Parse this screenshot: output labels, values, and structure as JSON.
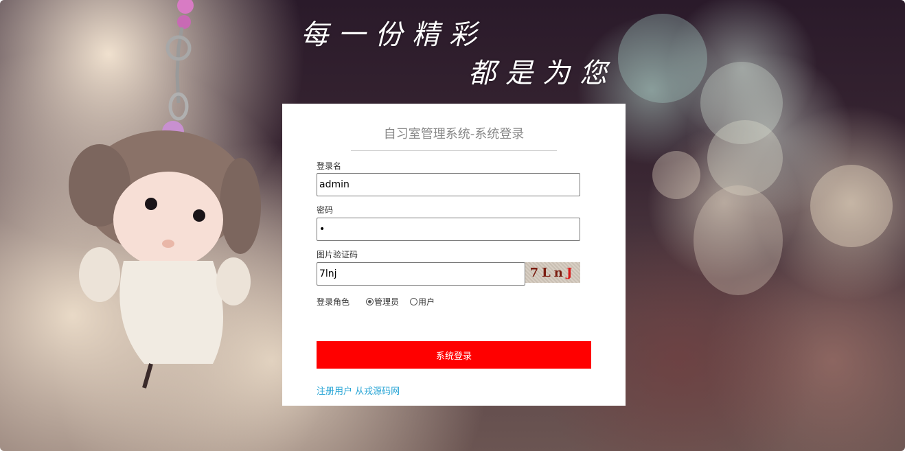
{
  "slogan": {
    "line1": "每一份精彩",
    "line2": "都是为您"
  },
  "login": {
    "title": "自习室管理系统-系统登录",
    "username_label": "登录名",
    "username_value": "admin",
    "password_label": "密码",
    "password_value": "•",
    "captcha_label": "图片验证码",
    "captcha_value": "7lnj",
    "captcha_image_text_main": "7Ln",
    "captcha_image_text_last": "J",
    "role_label": "登录角色",
    "role_options": [
      {
        "label": "管理员",
        "checked": true
      },
      {
        "label": "用户",
        "checked": false
      }
    ],
    "submit_label": "系统登录",
    "link_register": "注册用户",
    "link_source": "从戎源码网"
  },
  "colors": {
    "primary_button": "#ff0000",
    "link": "#2aa6d6"
  }
}
